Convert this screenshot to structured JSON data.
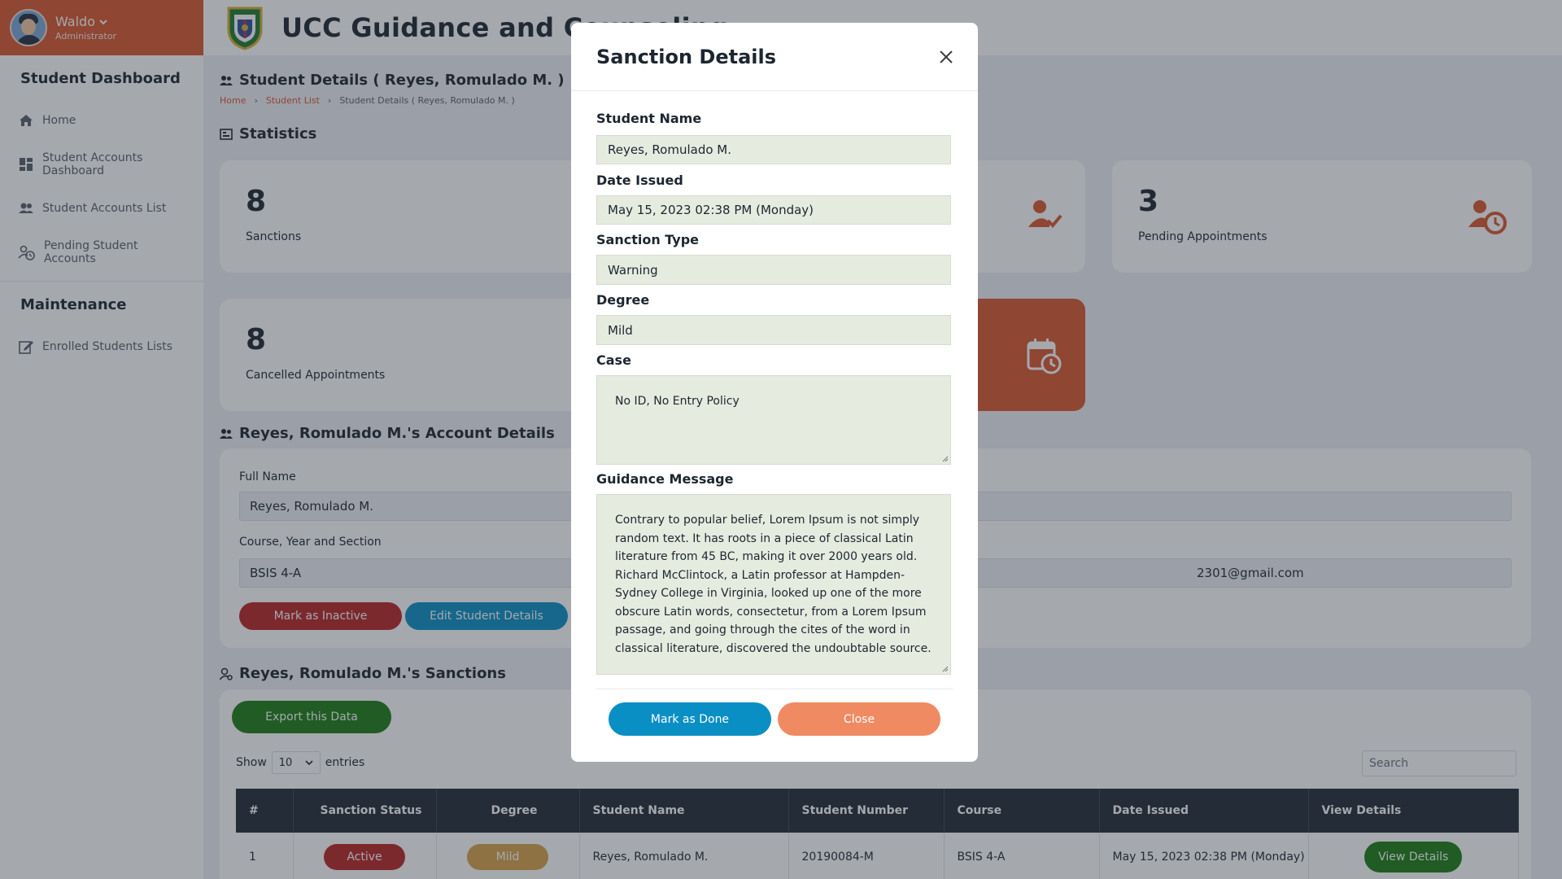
{
  "user": {
    "name": "Waldo",
    "role": "Administrator"
  },
  "sidebar": {
    "sections": [
      {
        "title": "Student Dashboard",
        "items": [
          "Home",
          "Student Accounts Dashboard",
          "Student Accounts List",
          "Pending Student Accounts"
        ]
      },
      {
        "title": "Maintenance",
        "items": [
          "Enrolled Students Lists"
        ]
      }
    ]
  },
  "header": {
    "title": "UCC Guidance and Counseling"
  },
  "page": {
    "title": "Student Details ( Reyes, Romulado M. )",
    "breadcrumb": [
      "Home",
      "Student List",
      "Student Details ( Reyes, Romulado M. )"
    ]
  },
  "statistics": {
    "title": "Statistics",
    "cards": [
      {
        "value": "8",
        "label": "Sanctions"
      },
      {
        "value": "3",
        "label": "Pending Appointments"
      },
      {
        "value": "8",
        "label": "Cancelled Appointments"
      }
    ]
  },
  "account": {
    "title": "Reyes, Romulado M.'s Account Details",
    "full_name_label": "Full Name",
    "full_name": "Reyes, Romulado M.",
    "course_label": "Course, Year and Section",
    "course": "BSIS 4-A",
    "email_partial": "2301@gmail.com",
    "inactive_btn": "Mark as Inactive",
    "edit_btn": "Edit Student Details"
  },
  "sanctions": {
    "title": "Reyes, Romulado M.'s Sanctions",
    "export_btn": "Export this Data",
    "show_label": "Show",
    "entries_value": "10",
    "entries_label": "entries",
    "search_placeholder": "Search",
    "columns": [
      "#",
      "Sanction Status",
      "Degree",
      "Student Name",
      "Student Number",
      "Course",
      "Date Issued",
      "View Details"
    ],
    "rows": [
      {
        "num": "1",
        "status": "Active",
        "degree": "Mild",
        "name": "Reyes, Romulado M.",
        "number": "20190084-M",
        "course": "BSIS 4-A",
        "date": "May 15, 2023 02:38 PM (Monday)",
        "action": "View Details"
      }
    ]
  },
  "modal": {
    "title": "Sanction Details",
    "student_name_label": "Student Name",
    "student_name": "Reyes, Romulado M.",
    "date_label": "Date Issued",
    "date": "May 15, 2023 02:38 PM (Monday)",
    "type_label": "Sanction Type",
    "type": "Warning",
    "degree_label": "Degree",
    "degree": "Mild",
    "case_label": "Case",
    "case": "No ID, No Entry Policy",
    "message_label": "Guidance Message",
    "message": "Contrary to popular belief, Lorem Ipsum is not simply random text. It has roots in a piece of classical Latin literature from 45 BC, making it over 2000 years old. Richard McClintock, a Latin professor at Hampden-Sydney College in Virginia, looked up one of the more obscure Latin words, consectetur, from a Lorem Ipsum passage, and going through the cites of the word in classical literature, discovered the undoubtable source.",
    "done_btn": "Mark as Done",
    "close_btn": "Close"
  },
  "colors": {
    "accent": "#d9562c",
    "dark": "#1f2a34",
    "blue": "#0a8fc4",
    "green": "#1b7d12",
    "red": "#b82525",
    "salmon": "#f08a63",
    "mild": "#d8a24a",
    "field_bg": "#e6ebe0"
  }
}
